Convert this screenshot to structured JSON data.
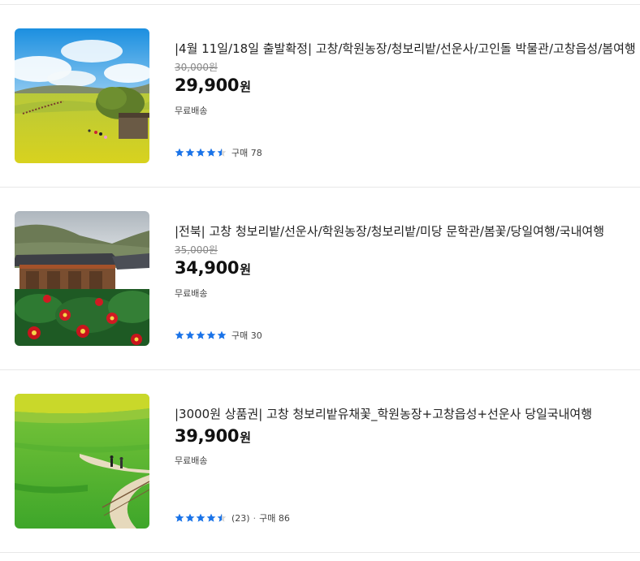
{
  "colors": {
    "star": "#1a73e8",
    "star_empty": "#d6d6d6",
    "divider": "#e8e8e8"
  },
  "products": [
    {
      "title": "|4월 11일/18일 출발확정| 고창/학원농장/청보리밭/선운사/고인돌 박물관/고창읍성/봄여행",
      "original_price": "30,000원",
      "price": "29,900",
      "price_unit": "원",
      "shipping": "무료배송",
      "rating": 4.5,
      "review_count": "",
      "purchase": "구매 78",
      "image_icon": "canola-field-hill-image"
    },
    {
      "title": "|전북| 고창 청보리밭/선운사/학원농장/청보리밭/미당 문학관/봄꽃/당일여행/국내여행",
      "original_price": "35,000원",
      "price": "34,900",
      "price_unit": "원",
      "shipping": "무료배송",
      "rating": 5,
      "review_count": "",
      "purchase": "구매 30",
      "image_icon": "temple-camellia-image"
    },
    {
      "title": "|3000원 상품권| 고창 청보리밭유채꽃_학원농장+고창읍성+선운사 당일국내여행",
      "original_price": "",
      "price": "39,900",
      "price_unit": "원",
      "shipping": "무료배송",
      "rating": 4.5,
      "review_count": "(23)",
      "separator": "·",
      "purchase": "구매 86",
      "image_icon": "green-barley-field-image"
    }
  ]
}
